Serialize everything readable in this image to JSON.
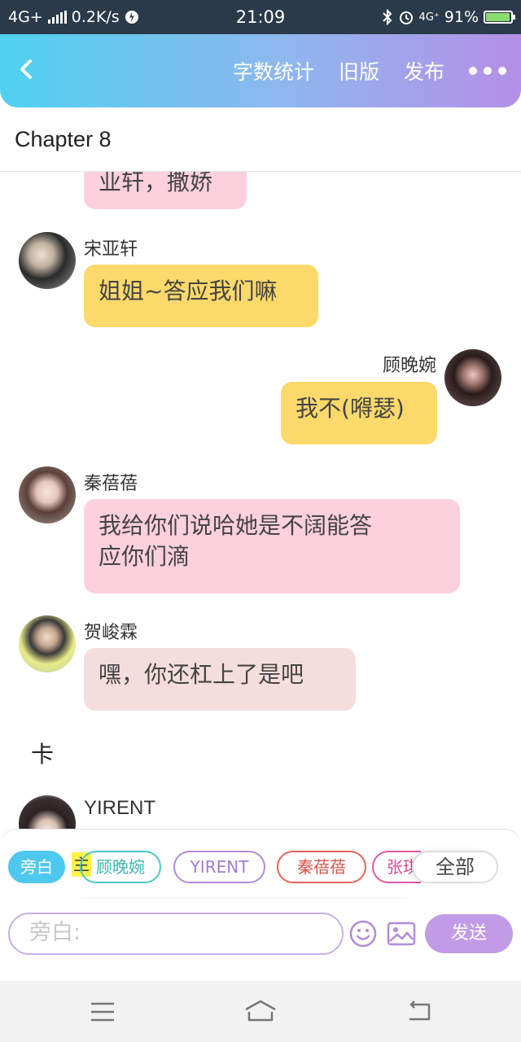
{
  "status_bar": {
    "network": "4G+",
    "speed": "0.2K/s",
    "time": "21:09",
    "signal_label": "4G⁺",
    "battery": "91%",
    "battery_level": 0.91
  },
  "header": {
    "back_icon": "chevron-left-icon",
    "actions": [
      "字数统计",
      "旧版",
      "发布"
    ],
    "more_icon": "more-dots-icon",
    "gradient": [
      "#4fd1ef",
      "#b48fe6"
    ]
  },
  "chapter_title": "Chapter 8",
  "messages": [
    {
      "speaker": "",
      "text": "业轩，撒娇",
      "color": "#fcd0dc"
    },
    {
      "speaker": "宋亚轩",
      "text": "姐姐~答应我们嘛",
      "color": "#fcd96a"
    },
    {
      "speaker": "顾晚婉",
      "text": "我不(嘚瑟)",
      "color": "#fcd96a"
    },
    {
      "speaker": "秦蓓蓓",
      "text_line1": "我给你们说哈她是不阔能答",
      "text_line2": "应你们滴",
      "color": "#fcd0dc"
    },
    {
      "speaker": "贺峻霖",
      "text": "嘿，你还杠上了是吧",
      "color": "#f6dddd"
    },
    {
      "narration": "卡"
    },
    {
      "speaker": "YIRENT"
    }
  ],
  "role_chips": [
    "旁白",
    "顾晚婉",
    "YIRENT",
    "秦蓓蓓",
    "张琪",
    "全部"
  ],
  "main_marker": "主",
  "input": {
    "placeholder": "旁白:",
    "send_label": "发送"
  },
  "icons": [
    "emoji-icon",
    "image-icon"
  ],
  "nav_icons": [
    "menu-icon",
    "home-icon",
    "back-icon"
  ]
}
